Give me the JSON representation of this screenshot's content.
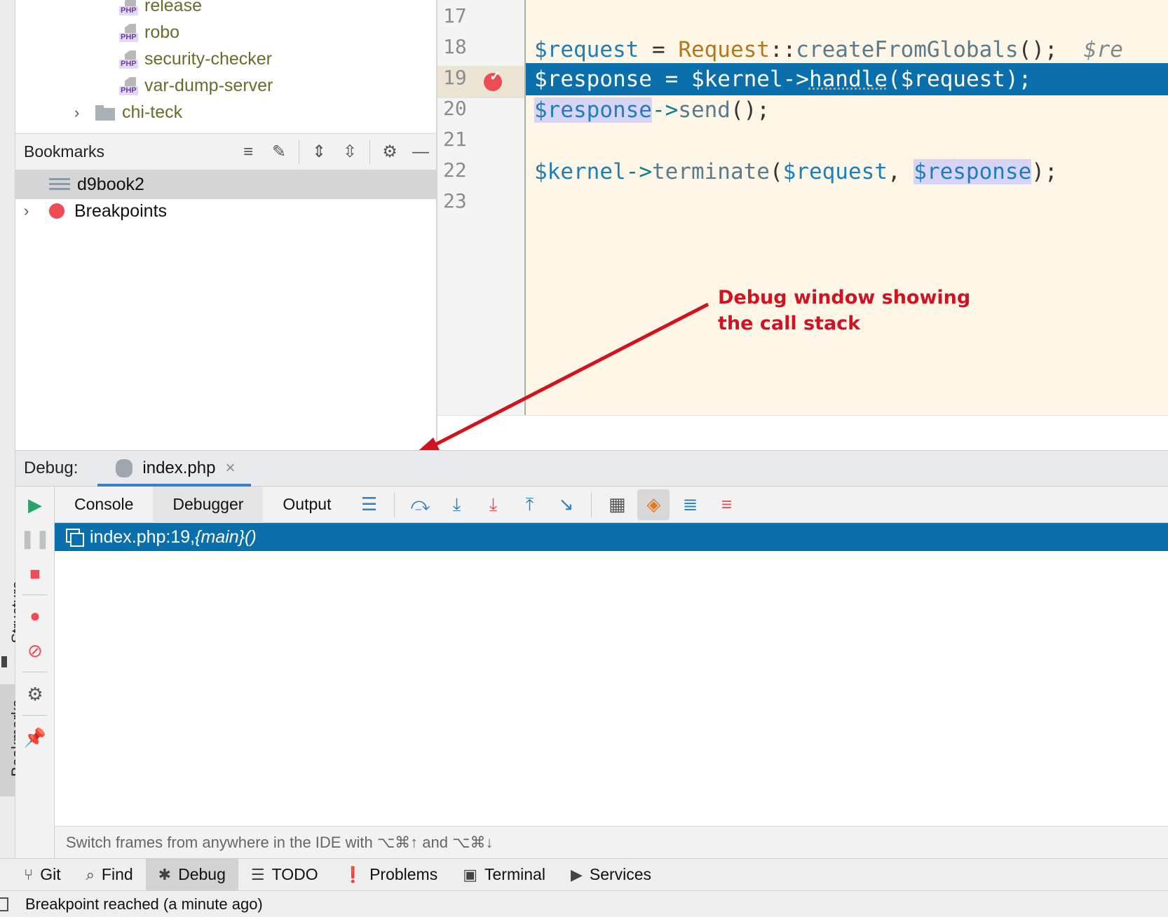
{
  "project_tree": {
    "items": [
      {
        "label": "release",
        "type": "php"
      },
      {
        "label": "robo",
        "type": "php"
      },
      {
        "label": "security-checker",
        "type": "php"
      },
      {
        "label": "var-dump-server",
        "type": "php"
      },
      {
        "label": "chi-teck",
        "type": "folder"
      }
    ],
    "php_tag": "PHP"
  },
  "side_tabs": {
    "structure": "Structure",
    "bookmarks": "Bookmarks"
  },
  "bookmarks": {
    "title": "Bookmarks",
    "rows": [
      {
        "label": "d9book2",
        "selected": true
      },
      {
        "label": "Breakpoints",
        "selected": false
      }
    ]
  },
  "editor": {
    "line_numbers": [
      "17",
      "18",
      "19",
      "20",
      "21",
      "22",
      "23"
    ],
    "execution_line": "19",
    "lines": {
      "l18": {
        "a": "$request",
        "b": " = ",
        "c": "Request",
        "d": "::",
        "e": "createFromGlobals",
        "f": "();",
        "g": "  $re"
      },
      "l19": {
        "a": "$response",
        "b": " = ",
        "c": "$kernel",
        "d": "->",
        "e": "handle",
        "f": "(",
        "g": "$request",
        "h": ");"
      },
      "l20": {
        "a": "$response",
        "b": "->",
        "c": "send",
        "d": "();"
      },
      "l22": {
        "a": "$kernel",
        "b": "->",
        "c": "terminate",
        "d": "(",
        "e": "$request",
        "f": ", ",
        "g": "$response",
        "h": ");"
      }
    },
    "colors": {
      "background": "#fdf5e6",
      "exec_line": "#0a6fab",
      "variable": "#1e7fb8",
      "class": "#b07a1c"
    }
  },
  "annotation": {
    "line1": "Debug window showing",
    "line2": "the call stack",
    "color": "#d3121d"
  },
  "debug": {
    "label": "Debug:",
    "tab": "index.php",
    "subtabs": [
      "Console",
      "Debugger",
      "Output"
    ],
    "active_subtab": "Debugger",
    "frame": {
      "location": "index.php:19, ",
      "function": "{main}()"
    },
    "hint": "Switch frames from anywhere in the IDE with ⌥⌘↑ and ⌥⌘↓",
    "toolbar_icons": [
      "frames-icon",
      "step-over-icon",
      "step-into-icon",
      "force-step-into-icon",
      "step-out-icon",
      "run-to-cursor-icon",
      "evaluate-icon",
      "class-filter-icon",
      "numbered-list-icon",
      "add-watch-icon"
    ],
    "side_icons": [
      "resume-icon",
      "pause-icon",
      "stop-icon",
      "view-breakpoints-icon",
      "mute-breakpoints-icon",
      "settings-icon",
      "pin-icon"
    ]
  },
  "bottom_bar": {
    "items": [
      {
        "label": "Git",
        "icon": "git-branch-icon"
      },
      {
        "label": "Find",
        "icon": "search-icon"
      },
      {
        "label": "Debug",
        "icon": "bug-icon",
        "active": true
      },
      {
        "label": "TODO",
        "icon": "list-icon"
      },
      {
        "label": "Problems",
        "icon": "warning-icon"
      },
      {
        "label": "Terminal",
        "icon": "terminal-icon"
      },
      {
        "label": "Services",
        "icon": "services-icon"
      }
    ]
  },
  "status": {
    "text": "Breakpoint reached (a minute ago)"
  }
}
